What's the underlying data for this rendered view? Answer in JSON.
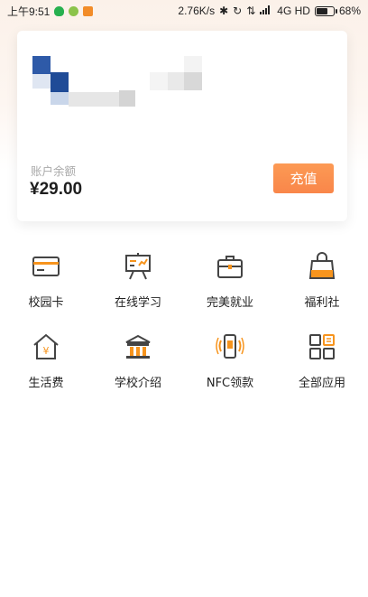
{
  "status_bar": {
    "time": "上午9:51",
    "net_speed": "2.76K/s",
    "network": "4G HD",
    "battery": "68%",
    "battery_level": 0.68
  },
  "card": {
    "balance_label": "账户余额",
    "balance": "¥29.00",
    "recharge_label": "充值"
  },
  "grid": {
    "items": [
      {
        "label": "校园卡",
        "icon": "card-icon"
      },
      {
        "label": "在线学习",
        "icon": "presentation-board-icon"
      },
      {
        "label": "完美就业",
        "icon": "briefcase-icon"
      },
      {
        "label": "福利社",
        "icon": "shopping-bag-icon"
      },
      {
        "label": "生活费",
        "icon": "house-yuan-icon"
      },
      {
        "label": "学校介绍",
        "icon": "school-building-icon"
      },
      {
        "label": "NFC领款",
        "icon": "nfc-phone-icon"
      },
      {
        "label": "全部应用",
        "icon": "all-apps-icon"
      }
    ]
  },
  "colors": {
    "accent": "#f98a4a",
    "icon_dark": "#444444",
    "icon_accent": "#f7941d"
  }
}
